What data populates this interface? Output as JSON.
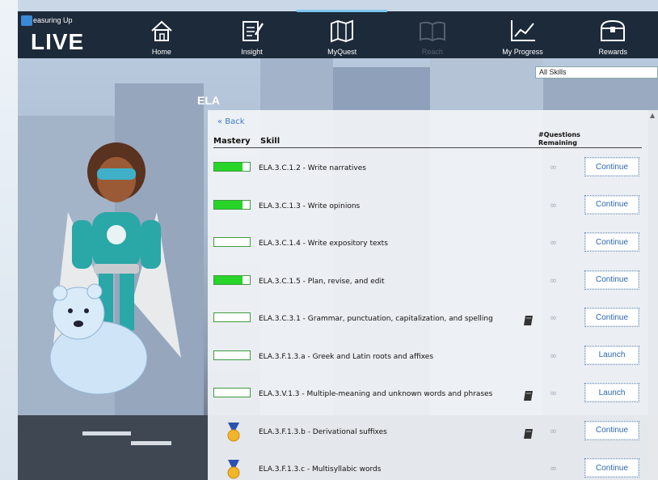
{
  "logo": {
    "small": "easuring Up",
    "big": "LIVE"
  },
  "nav": [
    {
      "label": "Home",
      "icon": "home-icon",
      "active": false,
      "dim": false
    },
    {
      "label": "Insight",
      "icon": "notepad-icon",
      "active": false,
      "dim": false
    },
    {
      "label": "MyQuest",
      "icon": "map-icon",
      "active": true,
      "dim": false
    },
    {
      "label": "Reach",
      "icon": "book-icon",
      "active": false,
      "dim": true
    },
    {
      "label": "My Progress",
      "icon": "chart-icon",
      "active": false,
      "dim": false
    },
    {
      "label": "Rewards",
      "icon": "treasure-chest-icon",
      "active": false,
      "dim": false
    }
  ],
  "filter": {
    "value": "All Skills"
  },
  "subject": "ELA",
  "back_label": "« Back",
  "table": {
    "headers": {
      "mastery": "Mastery",
      "skill": "Skill",
      "questions": "#Questions Remaining"
    },
    "rows": [
      {
        "mastery": 0.8,
        "medal": false,
        "skill": "ELA.3.C.1.2 - Write narratives",
        "book": false,
        "remaining": "∞",
        "action": "Continue"
      },
      {
        "mastery": 0.8,
        "medal": false,
        "skill": "ELA.3.C.1.3 - Write opinions",
        "book": false,
        "remaining": "∞",
        "action": "Continue"
      },
      {
        "mastery": 0.0,
        "medal": false,
        "skill": "ELA.3.C.1.4 - Write expository texts",
        "book": false,
        "remaining": "∞",
        "action": "Continue"
      },
      {
        "mastery": 0.8,
        "medal": false,
        "skill": "ELA.3.C.1.5 - Plan, revise, and edit",
        "book": false,
        "remaining": "∞",
        "action": "Continue"
      },
      {
        "mastery": 0.0,
        "medal": false,
        "skill": "ELA.3.C.3.1 - Grammar, punctuation, capitalization, and spelling",
        "book": true,
        "remaining": "∞",
        "action": "Continue"
      },
      {
        "mastery": 0.0,
        "medal": false,
        "skill": "ELA.3.F.1.3.a - Greek and Latin roots and affixes",
        "book": false,
        "remaining": "∞",
        "action": "Launch"
      },
      {
        "mastery": 0.0,
        "medal": false,
        "skill": "ELA.3.V.1.3 - Multiple-meaning and unknown words and phrases",
        "book": true,
        "remaining": "∞",
        "action": "Launch"
      },
      {
        "mastery": 1.0,
        "medal": true,
        "skill": "ELA.3.F.1.3.b - Derivational suffixes",
        "book": true,
        "remaining": "∞",
        "action": "Continue"
      },
      {
        "mastery": 1.0,
        "medal": true,
        "skill": "ELA.3.F.1.3.c - Multisyllabic words",
        "book": false,
        "remaining": "∞",
        "action": "Continue"
      }
    ]
  },
  "colors": {
    "nav_bg": "#1d2a3a",
    "mastery_fill": "#27d427",
    "button_text": "#2c66ad",
    "link": "#3a7ec8"
  }
}
